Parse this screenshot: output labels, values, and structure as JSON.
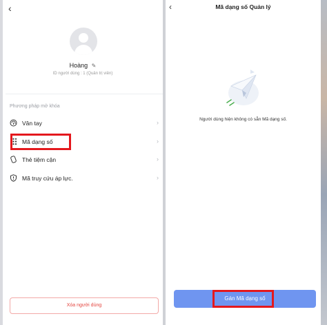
{
  "left_screen": {
    "back_icon": "‹",
    "user_name": "Hoàng",
    "edit_icon": "pencil-icon",
    "user_id_line": "ID người dùng : 1 (Quản trị viên)",
    "section_title": "Phương pháp mở khóa",
    "methods": [
      {
        "label": "Vân tay",
        "icon": "fingerprint-icon"
      },
      {
        "label": "Mã dạng số",
        "icon": "keypad-icon"
      },
      {
        "label": "Thẻ tiệm cận",
        "icon": "card-icon"
      },
      {
        "label": "Mã truy cứu áp lực.",
        "icon": "shield-icon"
      }
    ],
    "delete_button": "Xóa người dùng"
  },
  "right_screen": {
    "back_icon": "‹",
    "title": "Mã dạng số Quản lý",
    "illustration_icon": "paper-plane-icon",
    "empty_message": "Người dùng hiện không có sẵn Mã dạng số.",
    "assign_button": "Gán Mã dạng số"
  },
  "colors": {
    "highlight": "#e4181d",
    "primary_button": "#6f95f0",
    "danger_text": "#e4453f"
  }
}
